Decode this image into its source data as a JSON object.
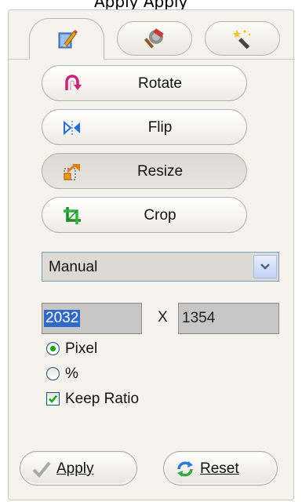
{
  "header_fragment": "Apply Apply",
  "tabs": [
    {
      "name": "edit",
      "icon": "pencil-icon",
      "active": true
    },
    {
      "name": "tools",
      "icon": "hammer-icon",
      "active": false
    },
    {
      "name": "effects",
      "icon": "magic-wand-icon",
      "active": false
    }
  ],
  "tools": {
    "rotate_label": "Rotate",
    "flip_label": "Flip",
    "resize_label": "Resize",
    "crop_label": "Crop"
  },
  "resize": {
    "mode": "Manual",
    "width": "2032",
    "separator": "X",
    "height": "1354",
    "unit_pixel_label": "Pixel",
    "unit_percent_label": "%",
    "selected_unit": "Pixel",
    "keep_ratio_label": "Keep Ratio",
    "keep_ratio_checked": true
  },
  "actions": {
    "apply_label": "Apply",
    "reset_label": "Reset"
  },
  "colors": {
    "panel": "#f4f3ee",
    "selection": "#3169c6",
    "radio_dot": "#21a121"
  }
}
